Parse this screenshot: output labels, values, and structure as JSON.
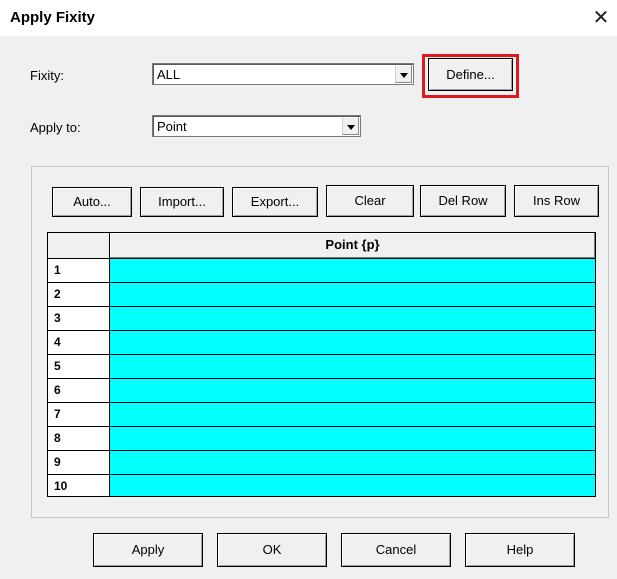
{
  "window": {
    "title": "Apply Fixity",
    "close_glyph": "✕"
  },
  "fixity": {
    "label": "Fixity:",
    "value": "ALL",
    "define_label": "Define..."
  },
  "apply_to": {
    "label": "Apply to:",
    "value": "Point"
  },
  "toolbar": {
    "auto": "Auto...",
    "import": "Import...",
    "export": "Export...",
    "clear": "Clear",
    "del_row": "Del Row",
    "ins_row": "Ins Row"
  },
  "table": {
    "column_header": "Point {p}",
    "rows": [
      "1",
      "2",
      "3",
      "4",
      "5",
      "6",
      "7",
      "8",
      "9",
      "10"
    ],
    "cell_color": "#00ffff"
  },
  "footer": {
    "apply": "Apply",
    "ok": "OK",
    "cancel": "Cancel",
    "help": "Help"
  },
  "colors": {
    "highlight": "#e0191f"
  }
}
